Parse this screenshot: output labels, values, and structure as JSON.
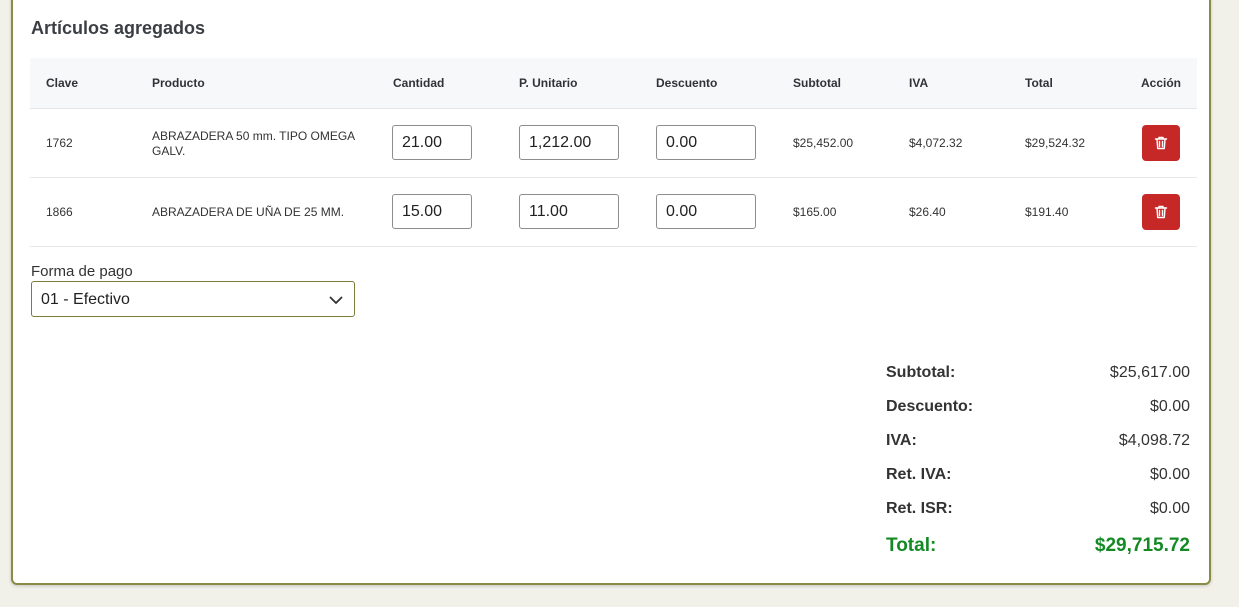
{
  "section_title": "Artículos agregados",
  "table": {
    "headers": {
      "clave": "Clave",
      "producto": "Producto",
      "cantidad": "Cantidad",
      "p_unitario": "P. Unitario",
      "descuento": "Descuento",
      "subtotal": "Subtotal",
      "iva": "IVA",
      "total": "Total",
      "accion": "Acción"
    },
    "rows": [
      {
        "clave": "1762",
        "producto": "ABRAZADERA 50 mm. TIPO OMEGA GALV.",
        "cantidad": "21.00",
        "p_unitario": "1,212.00",
        "descuento": "0.00",
        "subtotal": "$25,452.00",
        "iva": "$4,072.32",
        "total": "$29,524.32"
      },
      {
        "clave": "1866",
        "producto": "ABRAZADERA DE UÑA DE 25 MM.",
        "cantidad": "15.00",
        "p_unitario": "11.00",
        "descuento": "0.00",
        "subtotal": "$165.00",
        "iva": "$26.40",
        "total": "$191.40"
      }
    ]
  },
  "payment": {
    "label": "Forma de pago",
    "selected": "01 - Efectivo"
  },
  "summary": {
    "subtotal_label": "Subtotal:",
    "subtotal_value": "$25,617.00",
    "descuento_label": "Descuento:",
    "descuento_value": "$0.00",
    "iva_label": "IVA:",
    "iva_value": "$4,098.72",
    "ret_iva_label": "Ret. IVA:",
    "ret_iva_value": "$0.00",
    "ret_isr_label": "Ret. ISR:",
    "ret_isr_value": "$0.00",
    "total_label": "Total:",
    "total_value": "$29,715.72"
  },
  "icons": {
    "delete": "trash-icon",
    "select": "chevron-down-icon"
  },
  "colors": {
    "danger": "#c62828",
    "total": "#138a24",
    "accent_border": "#8b8b45"
  }
}
